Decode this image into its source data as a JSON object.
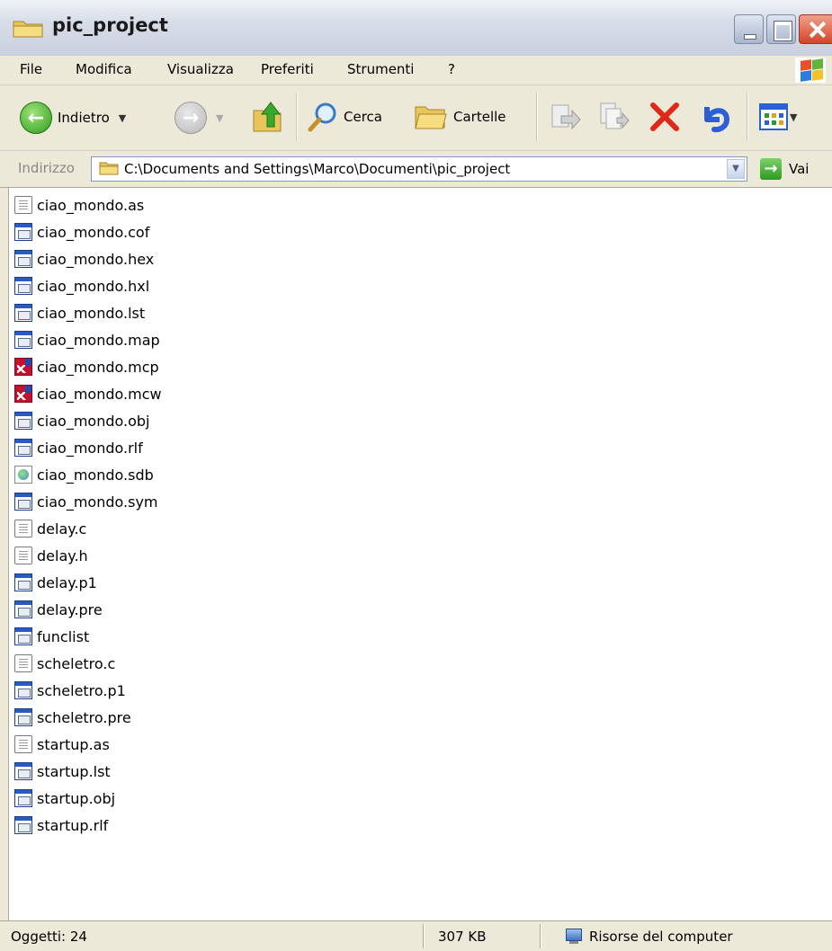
{
  "window": {
    "title": "pic_project"
  },
  "menu": [
    "File",
    "Modifica",
    "Visualizza",
    "Preferiti",
    "Strumenti",
    "?"
  ],
  "toolbar": {
    "back_label": "Indietro",
    "search_label": "Cerca",
    "folders_label": "Cartelle"
  },
  "address": {
    "label": "Indirizzo",
    "value": "C:\\Documents and Settings\\Marco\\Documenti\\pic_project",
    "go_label": "Vai"
  },
  "files": [
    {
      "name": "ciao_mondo.as",
      "icon": "text"
    },
    {
      "name": "ciao_mondo.cof",
      "icon": "generic"
    },
    {
      "name": "ciao_mondo.hex",
      "icon": "generic"
    },
    {
      "name": "ciao_mondo.hxl",
      "icon": "generic"
    },
    {
      "name": "ciao_mondo.lst",
      "icon": "generic"
    },
    {
      "name": "ciao_mondo.map",
      "icon": "generic"
    },
    {
      "name": "ciao_mondo.mcp",
      "icon": "mplab"
    },
    {
      "name": "ciao_mondo.mcw",
      "icon": "mplab"
    },
    {
      "name": "ciao_mondo.obj",
      "icon": "generic"
    },
    {
      "name": "ciao_mondo.rlf",
      "icon": "generic"
    },
    {
      "name": "ciao_mondo.sdb",
      "icon": "sdb"
    },
    {
      "name": "ciao_mondo.sym",
      "icon": "generic"
    },
    {
      "name": "delay.c",
      "icon": "text"
    },
    {
      "name": "delay.h",
      "icon": "text"
    },
    {
      "name": "delay.p1",
      "icon": "generic"
    },
    {
      "name": "delay.pre",
      "icon": "generic"
    },
    {
      "name": "funclist",
      "icon": "generic"
    },
    {
      "name": "scheletro.c",
      "icon": "text"
    },
    {
      "name": "scheletro.p1",
      "icon": "generic"
    },
    {
      "name": "scheletro.pre",
      "icon": "generic"
    },
    {
      "name": "startup.as",
      "icon": "text"
    },
    {
      "name": "startup.lst",
      "icon": "generic"
    },
    {
      "name": "startup.obj",
      "icon": "generic"
    },
    {
      "name": "startup.rlf",
      "icon": "generic"
    }
  ],
  "status": {
    "objects": "Oggetti: 24",
    "size": "307 KB",
    "location": "Risorse del computer"
  }
}
